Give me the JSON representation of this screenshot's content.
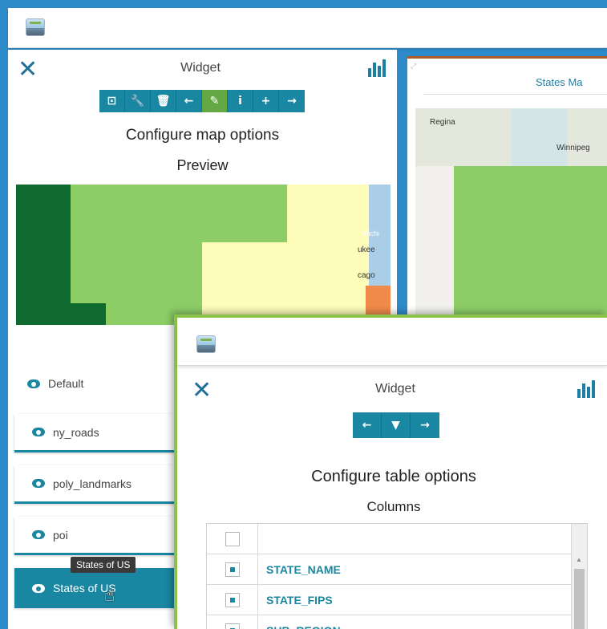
{
  "app": {
    "logo_alt": "logo"
  },
  "left_widget": {
    "title": "Widget",
    "toolbar": [
      {
        "icon": "zoom-extent-icon",
        "glyph": "⊡"
      },
      {
        "icon": "wrench-icon",
        "glyph": "🔧"
      },
      {
        "icon": "trash-icon",
        "glyph": "🗑"
      },
      {
        "icon": "arrow-left-icon",
        "glyph": "←"
      },
      {
        "icon": "pin-icon",
        "glyph": "✎"
      },
      {
        "icon": "info-icon",
        "glyph": "i"
      },
      {
        "icon": "plus-icon",
        "glyph": "+"
      },
      {
        "icon": "arrow-right-icon",
        "glyph": "→"
      }
    ],
    "heading": "Configure map options",
    "subheading": "Preview",
    "map_labels": [
      "Michi",
      "ukee",
      "cago"
    ],
    "layers": [
      {
        "label": "Default"
      },
      {
        "label": "ny_roads"
      },
      {
        "label": "poly_landmarks"
      },
      {
        "label": "poi"
      },
      {
        "label": "States of US"
      }
    ],
    "tooltip": "States of US"
  },
  "right_widget": {
    "title": "States Ma",
    "map_labels": [
      "Regina",
      "Winnipeg"
    ]
  },
  "table_widget": {
    "title": "Widget",
    "toolbar": [
      {
        "icon": "arrow-left-icon",
        "glyph": "←"
      },
      {
        "icon": "filter-icon",
        "glyph": "▼"
      },
      {
        "icon": "arrow-right-icon",
        "glyph": "→"
      }
    ],
    "heading": "Configure table options",
    "subheading": "Columns",
    "columns": [
      {
        "name": "",
        "checked": false
      },
      {
        "name": "STATE_NAME",
        "checked": true
      },
      {
        "name": "STATE_FIPS",
        "checked": true
      },
      {
        "name": "SUB_REGION",
        "checked": true
      }
    ]
  },
  "colors": {
    "accent": "#1a87a2",
    "active_tool": "#64a844",
    "overlay_border": "#8bc34a",
    "background": "#2e8bc9"
  }
}
